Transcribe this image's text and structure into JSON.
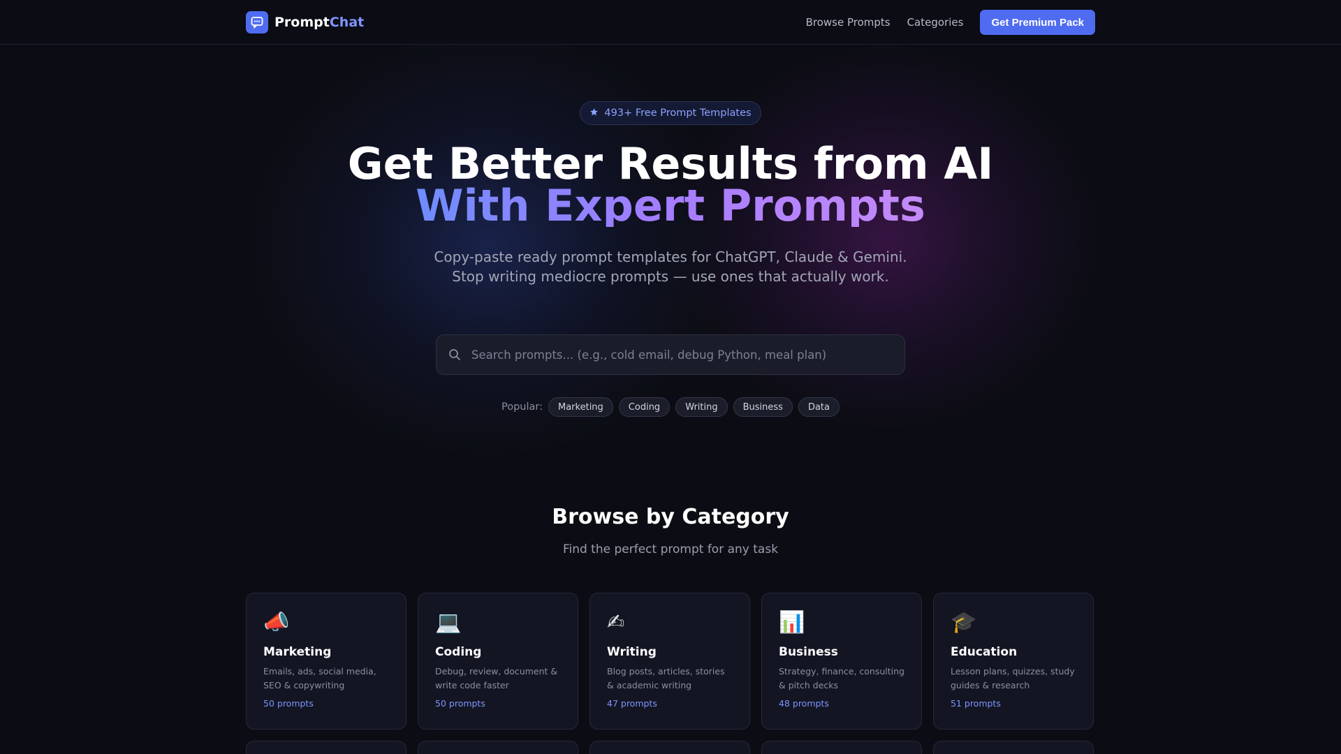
{
  "brand": {
    "name_part1": "Prompt",
    "name_part2": "Chat"
  },
  "nav": {
    "browse_label": "Browse Prompts",
    "categories_label": "Categories",
    "premium_label": "Get Premium Pack"
  },
  "hero": {
    "badge": "493+ Free Prompt Templates",
    "title_line1": "Get Better Results from AI",
    "title_line2": "With Expert Prompts",
    "subtitle": "Copy-paste ready prompt templates for ChatGPT, Claude & Gemini. Stop writing mediocre prompts — use ones that actually work."
  },
  "search": {
    "placeholder": "Search prompts... (e.g., cold email, debug Python, meal plan)",
    "value": ""
  },
  "popular": {
    "label": "Popular:",
    "chips": [
      "Marketing",
      "Coding",
      "Writing",
      "Business",
      "Data"
    ]
  },
  "categories_section": {
    "title": "Browse by Category",
    "subtitle": "Find the perfect prompt for any task",
    "cards": [
      {
        "icon": "📣",
        "icon_name": "megaphone-icon",
        "title": "Marketing",
        "desc": "Emails, ads, social media, SEO & copywriting",
        "count": "50 prompts"
      },
      {
        "icon": "💻",
        "icon_name": "laptop-icon",
        "title": "Coding",
        "desc": "Debug, review, document & write code faster",
        "count": "50 prompts"
      },
      {
        "icon": "✍",
        "icon_name": "writing-hand-icon",
        "title": "Writing",
        "desc": "Blog posts, articles, stories & academic writing",
        "count": "47 prompts"
      },
      {
        "icon": "📊",
        "icon_name": "bar-chart-icon",
        "title": "Business",
        "desc": "Strategy, finance, consulting & pitch decks",
        "count": "48 prompts"
      },
      {
        "icon": "🎓",
        "icon_name": "graduation-cap-icon",
        "title": "Education",
        "desc": "Lesson plans, quizzes, study guides & research",
        "count": "51 prompts"
      }
    ]
  },
  "colors": {
    "background": "#0c0d14",
    "accent": "#4f6cf0",
    "accent_text": "#7f95ff",
    "gradient_start": "#6f8cff",
    "gradient_end": "#c58af8"
  }
}
